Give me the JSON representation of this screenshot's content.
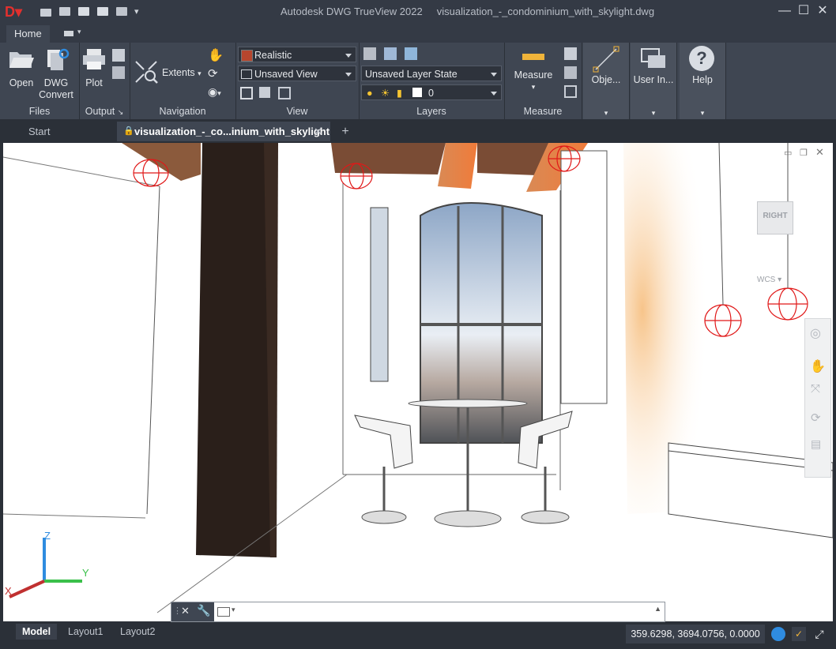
{
  "window": {
    "app_title": "Autodesk DWG TrueView 2022",
    "file_title": "visualization_-_condominium_with_skylight.dwg",
    "minimize": "—",
    "restore": "☐",
    "close": "✕"
  },
  "ribbon_tabs": [
    {
      "label": "Home"
    }
  ],
  "ribbon": {
    "files": {
      "label": "Files",
      "open": "Open",
      "dwg_convert": "DWG\nConvert"
    },
    "output": {
      "label": "Output",
      "plot": "Plot"
    },
    "navigation": {
      "label": "Navigation",
      "extents": "Extents"
    },
    "view": {
      "label": "View",
      "visual_style": "Realistic",
      "named_view": "Unsaved View"
    },
    "layers": {
      "label": "Layers",
      "layer_state": "Unsaved Layer State",
      "current_layer": "0"
    },
    "measure": {
      "label": "Measure",
      "measure": "Measure"
    },
    "object": {
      "label": "Obje..."
    },
    "user_interface": {
      "label": "User In..."
    },
    "help": {
      "label": "Help"
    }
  },
  "doc_tabs": [
    {
      "label": "Start"
    },
    {
      "label": "visualization_-_co...inium_with_skylight"
    }
  ],
  "viewport": {
    "viewcube_face": "RIGHT",
    "wcs_label": "WCS",
    "ucs": {
      "z": "Z",
      "y": "Y",
      "x": "X"
    }
  },
  "layout_tabs": [
    {
      "label": "Model"
    },
    {
      "label": "Layout1"
    },
    {
      "label": "Layout2"
    }
  ],
  "status": {
    "coordinates": "359.6298, 3694.0756, 0.0000"
  },
  "colors": {
    "accent_blue": "#2f8ce0",
    "beam_brown": "#8b5a3c",
    "beam_orange": "#e07a3f",
    "light_red": "#e01818",
    "column": "#2a1f1a"
  }
}
